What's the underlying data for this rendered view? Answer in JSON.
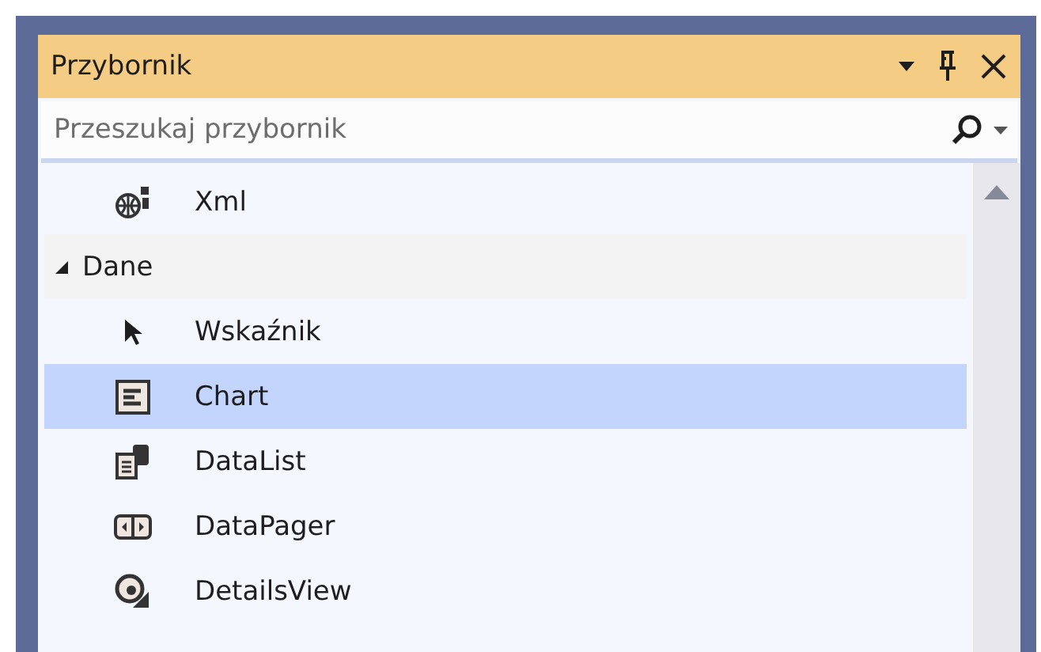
{
  "panel": {
    "title": "Przybornik"
  },
  "search": {
    "placeholder": "Przeszukaj przybornik"
  },
  "tree": [
    {
      "kind": "item",
      "label": "Xml",
      "selected": false
    },
    {
      "kind": "group",
      "label": "Dane",
      "expanded": true,
      "children": [
        {
          "kind": "item",
          "label": "Wskaźnik",
          "selected": false
        },
        {
          "kind": "item",
          "label": "Chart",
          "selected": true
        },
        {
          "kind": "item",
          "label": "DataList",
          "selected": false
        },
        {
          "kind": "item",
          "label": "DataPager",
          "selected": false
        },
        {
          "kind": "item",
          "label": "DetailsView",
          "selected": false
        }
      ]
    }
  ]
}
